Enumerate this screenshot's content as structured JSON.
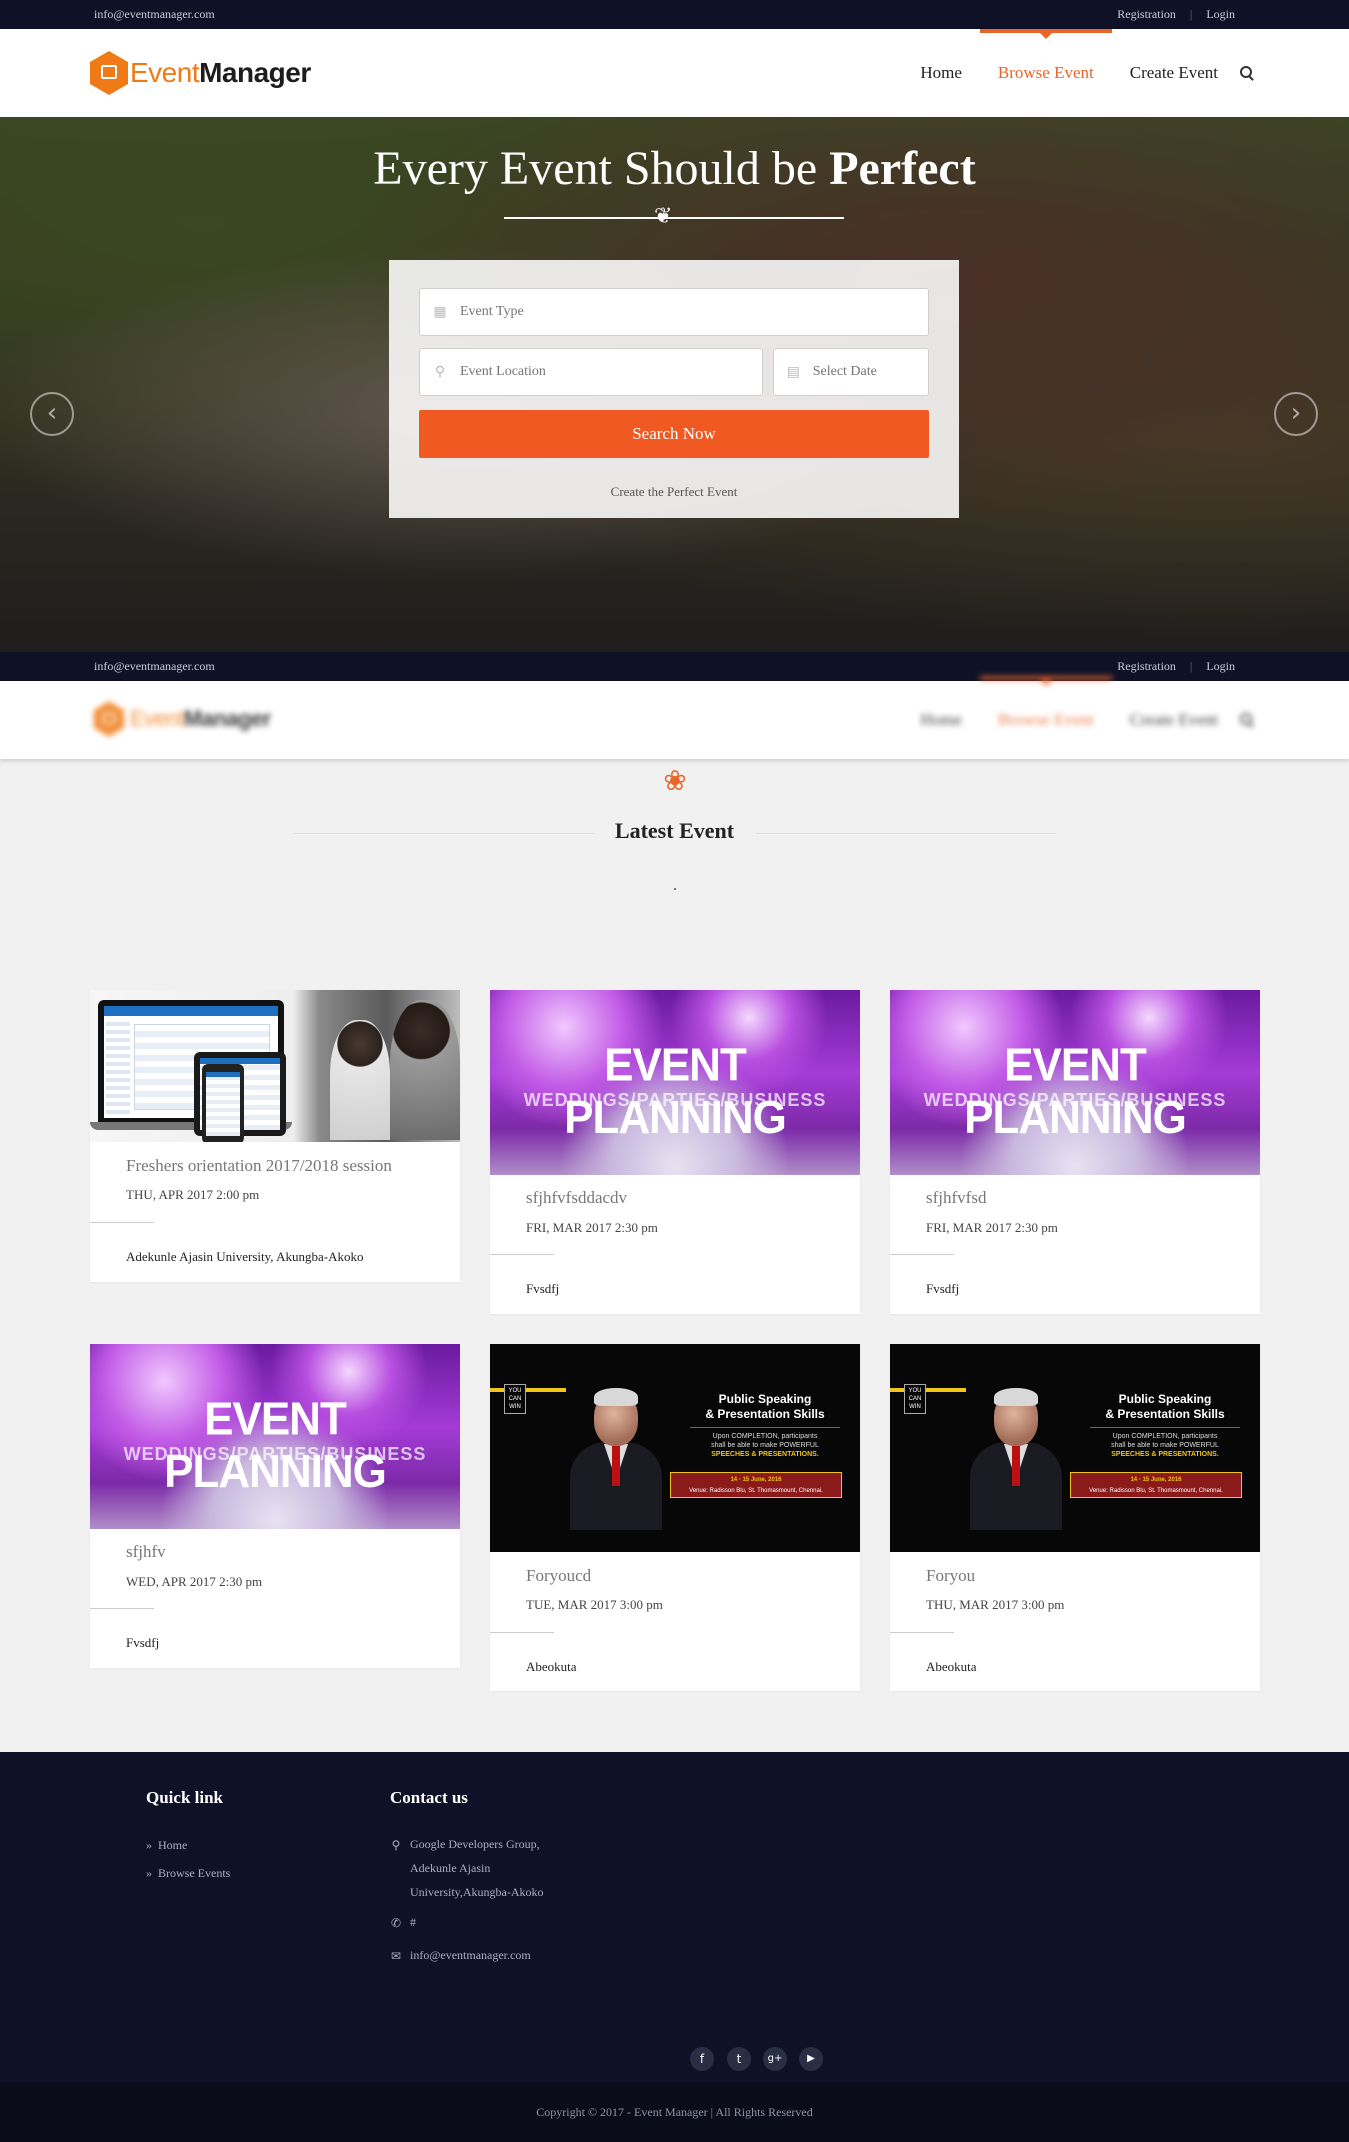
{
  "topbar": {
    "email": "info@eventmanager.com",
    "registration": "Registration",
    "sep": "|",
    "login": "Login"
  },
  "logo": {
    "part1": "Event",
    "part2": "Manager"
  },
  "nav": {
    "home": "Home",
    "browse": "Browse Event",
    "create": "Create Event",
    "icon": "search-icon"
  },
  "hero": {
    "title_plain": "Every Event Should be ",
    "title_bold": "Perfect",
    "event_type_placeholder": "Event Type",
    "location_placeholder": "Event Location",
    "date_placeholder": "Select Date",
    "search_label": "Search Now",
    "note": "Create the Perfect Event",
    "prev_icon": "chevron-left-icon",
    "next_icon": "chevron-right-icon"
  },
  "section": {
    "title": "Latest Event"
  },
  "events": [
    {
      "title": "Freshers orientation 2017/2018 session",
      "date": "THU, APR 2017 2:00 pm",
      "location": "Adekunle Ajasin University, Akungba-Akoko",
      "image": "laptop-students"
    },
    {
      "title": "sfjhfvfsddacdv",
      "date": "FRI, MAR 2017 2:30 pm",
      "location": "Fvsdfj",
      "image": "event-planning"
    },
    {
      "title": "sfjhfvfsd",
      "date": "FRI, MAR 2017 2:30 pm",
      "location": "Fvsdfj",
      "image": "event-planning"
    },
    {
      "title": "sfjhfv",
      "date": "WED, APR 2017 2:30 pm",
      "location": "Fvsdfj",
      "image": "event-planning"
    },
    {
      "title": "Foryoucd",
      "date": "TUE, MAR 2017 3:00 pm",
      "location": "Abeokuta",
      "image": "public-speaking"
    },
    {
      "title": "Foryou",
      "date": "THU, MAR 2017 3:00 pm",
      "location": "Abeokuta",
      "image": "public-speaking"
    }
  ],
  "poster_ep": {
    "line1": "EVENT PLANNING",
    "line2": "WEDDINGS/PARTIES/BUSINESS"
  },
  "poster_ps": {
    "badge": "YOU CAN WIN",
    "heading1": "Public Speaking",
    "heading2": "& Presentation Skills",
    "p1": "Upon COMPLETION, participants",
    "p2": "shall be able to make POWERFUL",
    "p3": "SPEECHES & PRESENTATIONS.",
    "dates": "14 - 15 June, 2016",
    "venue": "Venue: Radisson Blu, St. Thomasmount, Chennai."
  },
  "footer": {
    "quick_title": "Quick link",
    "quick_links": [
      "Home",
      "Browse Events"
    ],
    "contact_title": "Contact us",
    "address1": "Google Developers Group,",
    "address2": "Adekunle Ajasin",
    "address3": "University,Akungba-Akoko",
    "phone": "#",
    "email": "info@eventmanager.com",
    "social": [
      "f",
      "t",
      "g+",
      "▶"
    ],
    "copyright": "Copyright © 2017 - Event Manager | All Rights Reserved"
  },
  "colors": {
    "accent": "#f05a22",
    "nav_active": "#e9652a",
    "dark": "#0f1226"
  }
}
